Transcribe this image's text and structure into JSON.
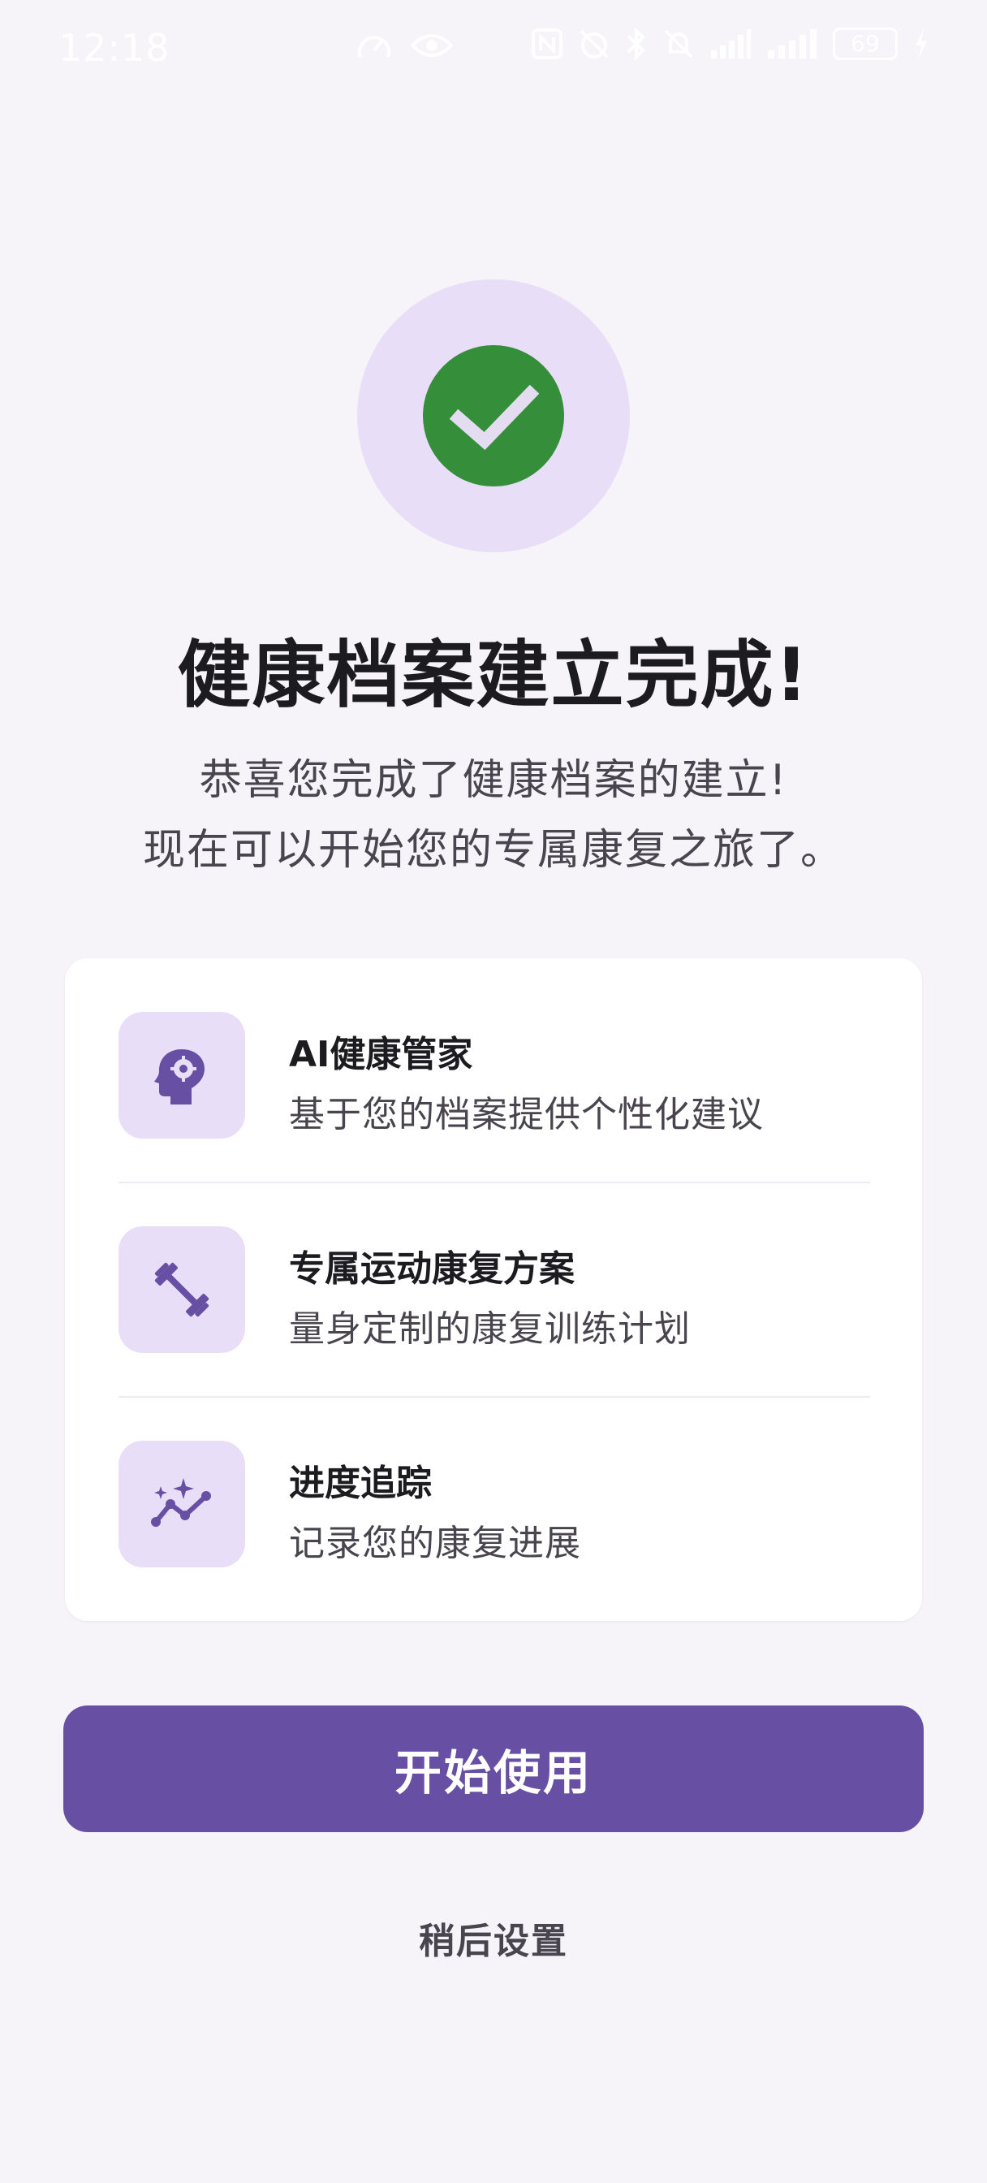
{
  "status_bar": {
    "time": "12:18",
    "battery": "69"
  },
  "main": {
    "title": "健康档案建立完成!",
    "subtitle_line1": "恭喜您完成了健康档案的建立!",
    "subtitle_line2": "现在可以开始您的专属康复之旅了。"
  },
  "features": [
    {
      "icon": "psychology-icon",
      "title": "AI健康管家",
      "desc": "基于您的档案提供个性化建议"
    },
    {
      "icon": "fitness-dumbbell-icon",
      "title": "专属运动康复方案",
      "desc": "量身定制的康复训练计划"
    },
    {
      "icon": "progress-chart-icon",
      "title": "进度追踪",
      "desc": "记录您的康复进展"
    }
  ],
  "actions": {
    "primary_label": "开始使用",
    "secondary_label": "稍后设置"
  },
  "colors": {
    "background": "#f6f3f9",
    "primary": "#6750a4",
    "icon_container": "#e9def8",
    "success": "#358e3a",
    "icon_foreground": "#6750a4"
  }
}
